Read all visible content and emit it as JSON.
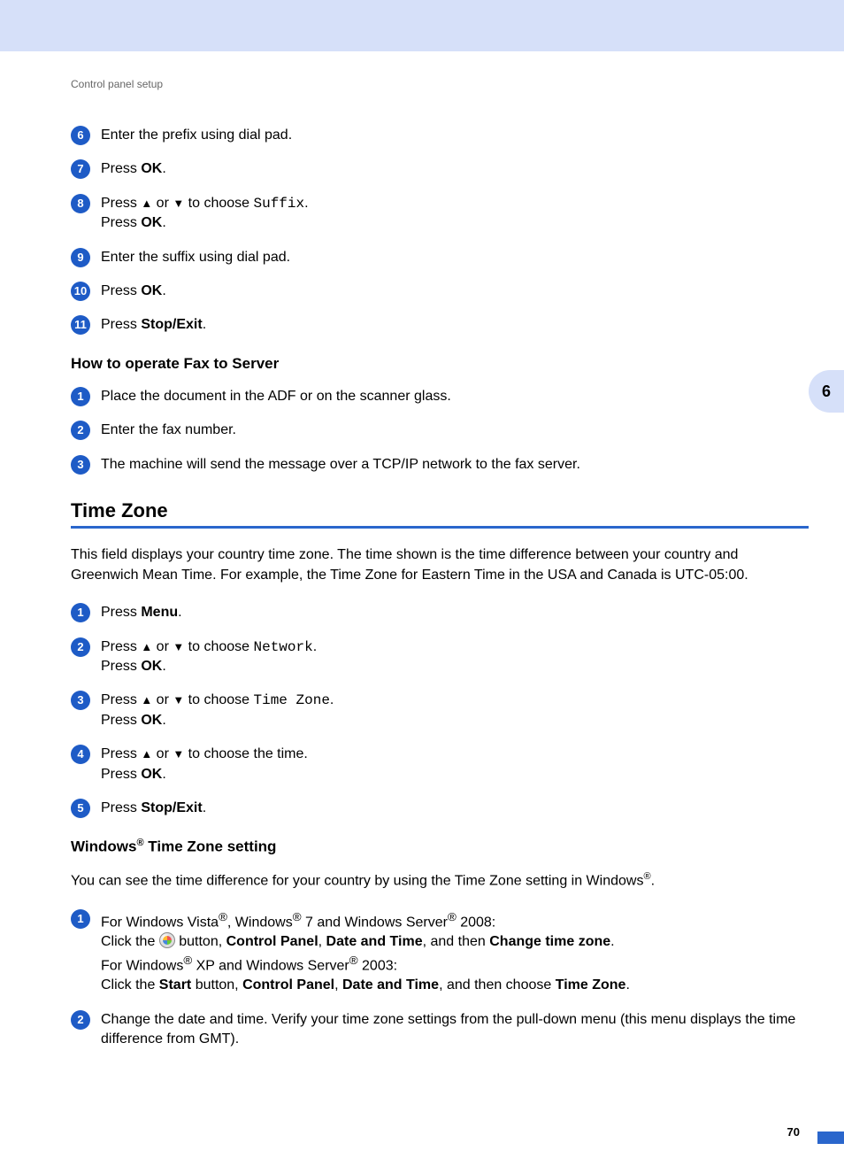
{
  "breadcrumb": "Control panel setup",
  "steps_top": [
    {
      "n": "6",
      "html": "Enter the prefix using dial pad."
    },
    {
      "n": "7",
      "html": "Press <b>OK</b>."
    },
    {
      "n": "8",
      "html": "Press <span class='arrow'>▲</span> or <span class='arrow'>▼</span> to choose <span class='mono'>Suffix</span>.<br>Press <b>OK</b>."
    },
    {
      "n": "9",
      "html": "Enter the suffix using dial pad."
    },
    {
      "n": "10",
      "html": "Press <b>OK</b>."
    },
    {
      "n": "11",
      "html": "Press <b>Stop/Exit</b>."
    }
  ],
  "sub1": "How to operate Fax to Server",
  "steps_fax": [
    {
      "n": "1",
      "html": "Place the document in the ADF or on the scanner glass."
    },
    {
      "n": "2",
      "html": "Enter the fax number."
    },
    {
      "n": "3",
      "html": "The machine will send the message over a TCP/IP network to the fax server."
    }
  ],
  "section": "Time Zone",
  "section_body": "This field displays your country time zone. The time shown is the time difference between your country and Greenwich Mean Time. For example, the Time Zone for Eastern Time in the USA and Canada is UTC-05:00.",
  "steps_tz": [
    {
      "n": "1",
      "html": "Press <b>Menu</b>."
    },
    {
      "n": "2",
      "html": "Press <span class='arrow'>▲</span> or <span class='arrow'>▼</span> to choose <span class='mono'>Network</span>.<br>Press <b>OK</b>."
    },
    {
      "n": "3",
      "html": "Press <span class='arrow'>▲</span> or <span class='arrow'>▼</span> to choose <span class='mono'>Time Zone</span>.<br>Press <b>OK</b>."
    },
    {
      "n": "4",
      "html": "Press <span class='arrow'>▲</span> or <span class='arrow'>▼</span> to choose the time.<br>Press <b>OK</b>."
    },
    {
      "n": "5",
      "html": "Press <b>Stop/Exit</b>."
    }
  ],
  "sub2_html": "Windows<sup>®</sup> Time Zone setting",
  "sub2_body_html": "You can see the time difference for your country by using the Time Zone setting in Windows<sup>®</sup>.",
  "steps_win": [
    {
      "n": "1",
      "html": "For Windows Vista<sup>®</sup>, Windows<sup>®</sup> 7 and Windows Server<sup>®</sup> 2008:<br>Click the <span class='win-icon' data-name='windows-start-icon' data-interactable='false'></span> button, <b>Control Panel</b>, <b>Date and Time</b>, and then <b>Change time zone</b>.<br>For Windows<sup>®</sup> XP and Windows Server<sup>®</sup> 2003:<br>Click the <b>Start</b> button, <b>Control Panel</b>, <b>Date and Time</b>, and then choose <b>Time Zone</b>."
    },
    {
      "n": "2",
      "html": "Change the date and time. Verify your time zone settings from the pull-down menu (this menu displays the time difference from GMT)."
    }
  ],
  "side_tab": "6",
  "page_number": "70"
}
